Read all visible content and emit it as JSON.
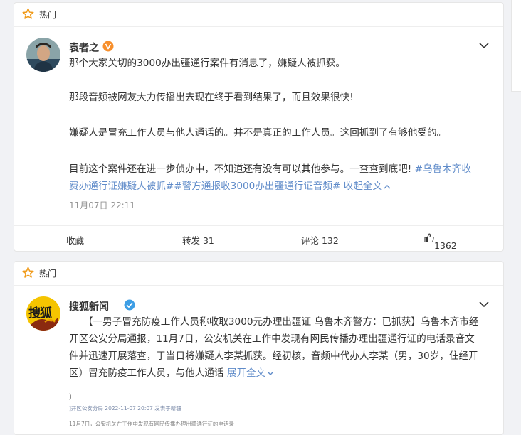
{
  "hot_label": "热门",
  "post1": {
    "author": "袁者之",
    "paragraphs": [
      "那个大家关切的3000办出疆通行案件有消息了，嫌疑人被抓获。",
      "那段音频被网友大力传播出去现在终于看到结果了，而且效果很快!",
      "嫌疑人是冒充工作人员与他人通话的。并不是真正的工作人员。这回抓到了有够他受的。"
    ],
    "last_paragraph_text": "目前这个案件还在进一步侦办中，不知道还有没有可以其他参与。一查查到底吧!",
    "topic1": "#乌鲁木齐收",
    "topic1_cont": "费办通行证嫌疑人被抓#",
    "topic2": "#警方通报收3000办出疆通行证音频#",
    "collapse": "收起全文",
    "timestamp": "11月07日 22:11",
    "actions": {
      "favorite": "收藏",
      "repost": "转发 31",
      "comment": "评论 132",
      "like": "1362"
    }
  },
  "post2": {
    "author": "搜狐新闻",
    "logo_text": "搜狐",
    "lines": [
      "【一男子冒充防疫工作人员称收取3000元办理出疆证 乌鲁木齐警方：已抓获】乌鲁木齐市经",
      "开区公安分局通报，11月7日，公安机关在工作中发现有网民传播办理出疆通行证的电话录音文",
      "件并迅速开展落查，于当日将嫌疑人李某抓获。经初核，音频中代办人李某（男，30岁，住经开"
    ],
    "last_line": "区）冒充防疫工作人员，与他人通话",
    "expand": "展开全文",
    "thumb_lines": [
      "）",
      "]开区公安分局  2022-11-07 20:07  发表于新疆",
      "11月7日，公安机关在工作中发现有网民传播办理出疆通行证的电话录"
    ]
  },
  "colors": {
    "link": "#5f8bc9",
    "orange_badge": "#f78f2c",
    "blue_badge": "#3d9ee5"
  }
}
